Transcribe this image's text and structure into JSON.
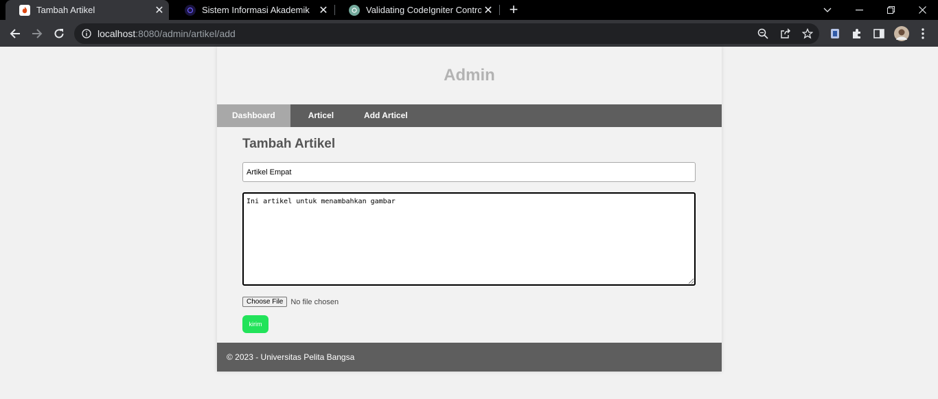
{
  "browser": {
    "tabs": [
      {
        "title": "Tambah Artikel",
        "active": true
      },
      {
        "title": "Sistem Informasi Akademik",
        "active": false
      },
      {
        "title": "Validating CodeIgniter Controller",
        "active": false
      }
    ],
    "new_tab_icon": "+",
    "url_host": "localhost",
    "url_path": ":8080/admin/artikel/add"
  },
  "page": {
    "site_title": "Admin",
    "nav": [
      {
        "label": "Dashboard",
        "active": true
      },
      {
        "label": "Articel",
        "active": false
      },
      {
        "label": "Add Articel",
        "active": false
      }
    ],
    "form": {
      "heading": "Tambah Artikel",
      "title_value": "Artikel Empat",
      "content_value": "Ini artikel untuk menambahkan gambar",
      "file_button_label": "Choose File",
      "file_status": "No file chosen",
      "submit_label": "kirim"
    },
    "footer": "© 2023 - Universitas Pelita Bangsa"
  },
  "colors": {
    "nav_bg": "#5e5e5e",
    "nav_active": "#a8a8a8",
    "submit_bg": "#22e35a",
    "header_text": "#b3b3b3"
  }
}
